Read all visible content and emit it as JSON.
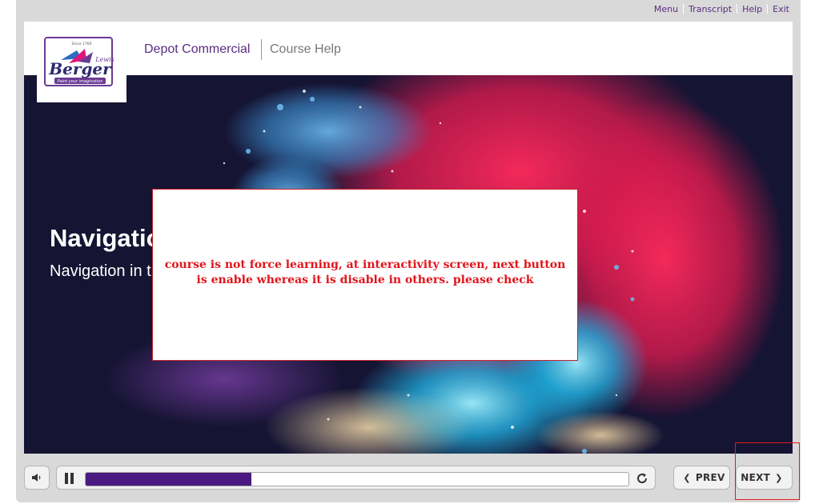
{
  "top_nav": {
    "menu": "Menu",
    "transcript": "Transcript",
    "help": "Help",
    "exit": "Exit"
  },
  "header": {
    "logo": {
      "brand": "Berger",
      "since": "Since 1760",
      "script": "Lewis",
      "tagline": "Paint your imagination"
    },
    "course_title": "Depot Commercial",
    "course_help": "Course Help"
  },
  "slide": {
    "title": "Navigatio",
    "subtitle": "Navigation in t"
  },
  "review_comment": {
    "text": "course is not force learning, at interactivity screen, next button is enable whereas it is disable in others. please check"
  },
  "controls": {
    "volume_icon": "speaker-icon",
    "pause_icon": "pause-icon",
    "replay_icon": "replay-icon",
    "progress_fraction": 0.305,
    "prev_label": "PREV",
    "next_label": "NEXT"
  },
  "colors": {
    "accent_purple": "#5a2d82",
    "progress_fill": "#4a1a82",
    "comment_red": "#e0151b",
    "highlight_red": "#e01b1b"
  }
}
